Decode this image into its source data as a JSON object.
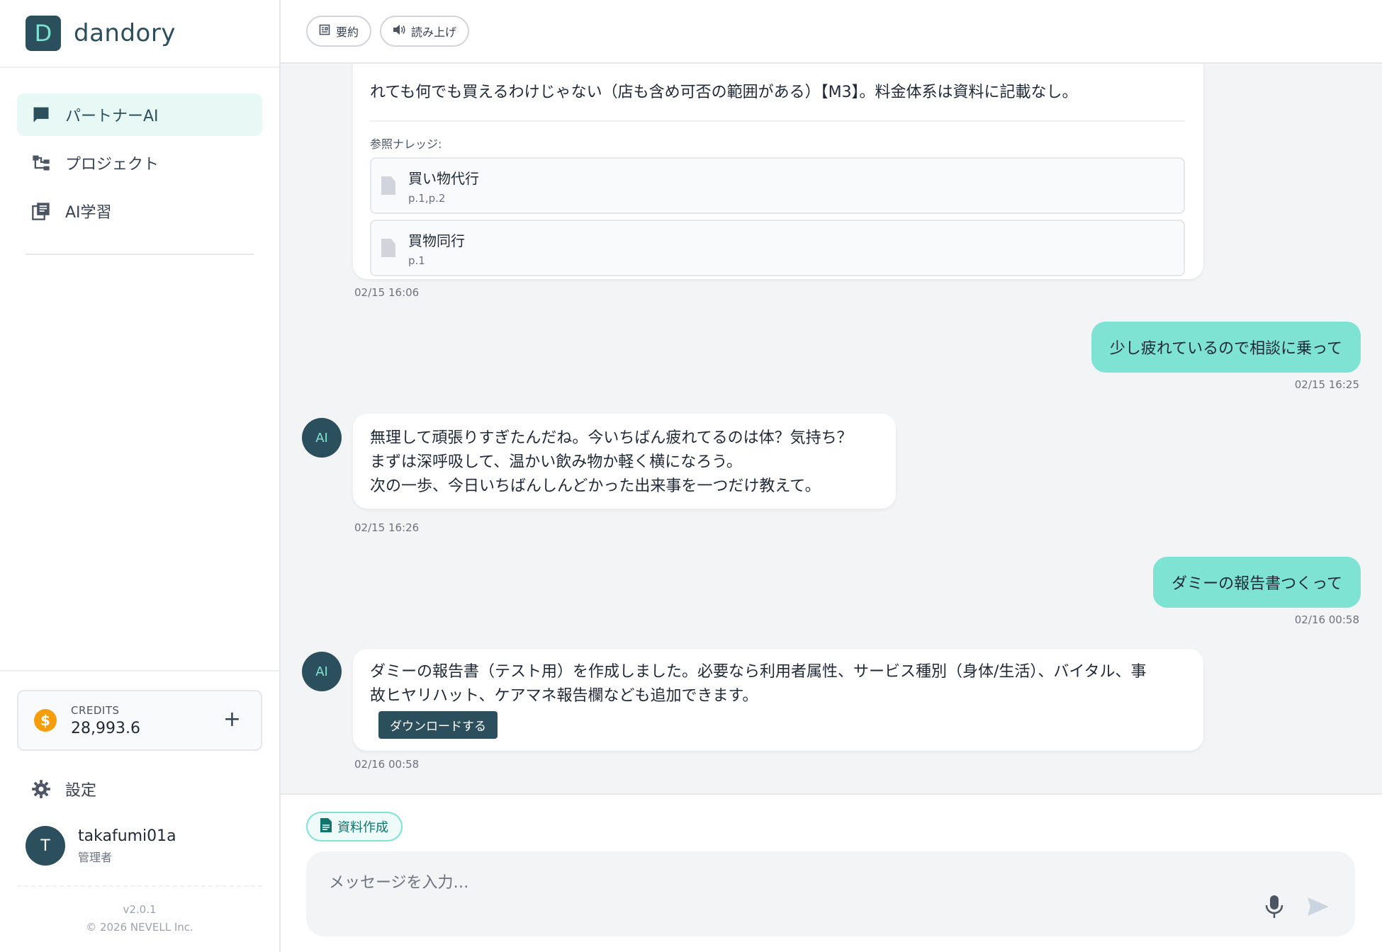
{
  "brand": {
    "logo_letter": "D",
    "name": "dandory"
  },
  "nav": {
    "items": [
      {
        "label": "パートナーAI",
        "icon": "chat-bubble-icon",
        "active": true
      },
      {
        "label": "プロジェクト",
        "icon": "project-tree-icon",
        "active": false
      },
      {
        "label": "AI学習",
        "icon": "library-icon",
        "active": false
      }
    ]
  },
  "credits": {
    "label": "CREDITS",
    "value": "28,993.6",
    "add": "+",
    "coin_symbol": "$"
  },
  "settings": {
    "label": "設定"
  },
  "user": {
    "initial": "T",
    "name": "takafumi01a",
    "role": "管理者"
  },
  "footer": {
    "version": "v2.0.1",
    "copyright": "© 2026 NEVELL Inc."
  },
  "toolbar": {
    "summary_label": "要約",
    "read_aloud_label": "読み上げ"
  },
  "messages": {
    "m1": {
      "text": "れても何でも買えるわけじゃない（店も含め可否の範囲がある）【M3】。料金体系は資料に記載なし。",
      "refs_label": "参照ナレッジ:",
      "refs": [
        {
          "title": "買い物代行",
          "pages": "p.1,p.2"
        },
        {
          "title": "買物同行",
          "pages": "p.1"
        }
      ],
      "time": "02/15 16:06"
    },
    "m2": {
      "text": "少し疲れているので相談に乗って",
      "time": "02/15 16:25"
    },
    "m3": {
      "avatar": "AI",
      "line1": "無理して頑張りすぎたんだね。今いちばん疲れてるのは体？気持ち？",
      "line2": "まずは深呼吸して、温かい飲み物か軽く横になろう。",
      "line3": "次の一歩、今日いちばんしんどかった出来事を一つだけ教えて。",
      "time": "02/15 16:26"
    },
    "m4": {
      "text": "ダミーの報告書つくって",
      "time": "02/16 00:58"
    },
    "m5": {
      "avatar": "AI",
      "line1": "ダミーの報告書（テスト用）を作成しました。必要なら利用者属性、サービス種別（身体/生活）、バイタル、事",
      "line2": "故ヒヤリハット、ケアマネ報告欄なども追加できます。",
      "download_label": "ダウンロードする",
      "time": "02/16 00:58"
    }
  },
  "composer": {
    "chip_label": "資料作成",
    "placeholder": "メッセージを入力…"
  },
  "colors": {
    "primary": "#2c4f5e",
    "accent": "#7fe3d3",
    "coin": "#f59e0b"
  }
}
